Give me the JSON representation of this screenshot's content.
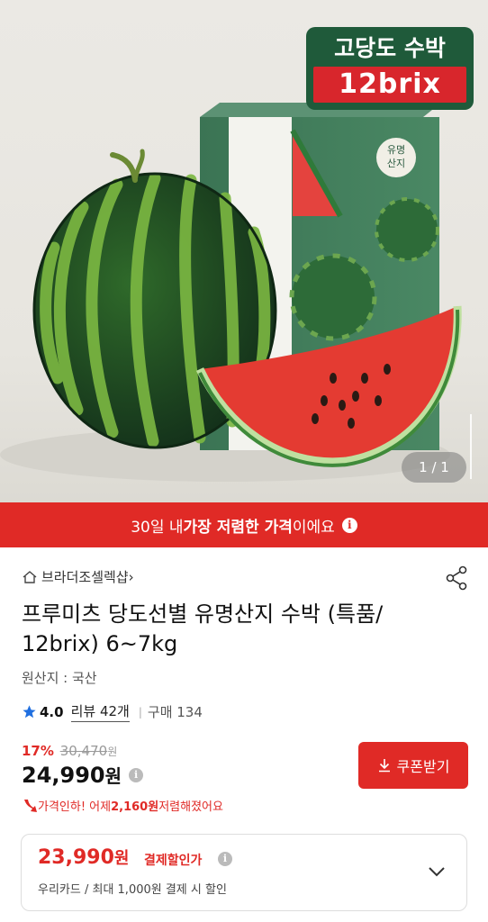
{
  "hero": {
    "badge_title": "고당도 수박",
    "badge_brix": "12brix",
    "box_label": "유명\n산지",
    "counter": "1 / 1"
  },
  "promo": {
    "prefix": "30일 내 ",
    "bold": "가장 저렴한 가격",
    "suffix": "이에요",
    "info_icon": "i"
  },
  "store": {
    "name": "브라더조셀렉샵",
    "arrow": "›"
  },
  "product": {
    "title": "프루미츠 당도선별 유명산지 수박 (특품/ 12brix) 6~7kg",
    "origin": "원산지 : 국산"
  },
  "rating": {
    "score": "4.0",
    "reviews": "리뷰 42개",
    "purchases": "구매 134",
    "sep": "|"
  },
  "pricing": {
    "discount_pct": "17%",
    "original": "30,470",
    "original_unit": "원",
    "price": "24,990",
    "price_unit": "원",
    "info_icon": "i",
    "coupon_label": "쿠폰받기",
    "drop_prefix": "가격인하! 어제 ",
    "drop_amount": "2,160원",
    "drop_suffix": " 저렴해졌어요"
  },
  "card": {
    "price": "23,990",
    "unit": "원",
    "label": "결제할인가",
    "info_icon": "i",
    "sub": "우리카드 / 최대 1,000원 결제 시 할인"
  },
  "colors": {
    "accent": "#e02a26",
    "badge_green": "#1f5a3a",
    "box_green": "#3f7a5a"
  }
}
